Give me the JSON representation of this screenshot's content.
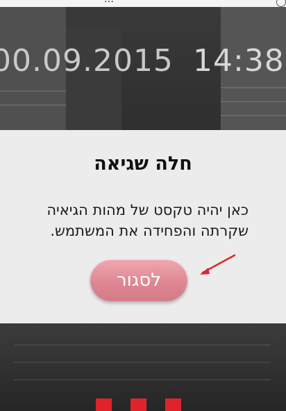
{
  "status_bar": {
    "text": "…"
  },
  "header": {
    "date": "00.09.2015",
    "time": "14:38"
  },
  "dialog": {
    "title": "חלה שגיאה",
    "message_line1": "כאן יהיה טקסט של מהות הגיאיה",
    "message_line2": "שקרתה והפחידה את המשתמש.",
    "close_label": "לסגור"
  },
  "colors": {
    "button": "#dd8590",
    "dialog_bg": "#ececec",
    "accent_red": "#e0232b",
    "arrow": "#e0232b"
  }
}
